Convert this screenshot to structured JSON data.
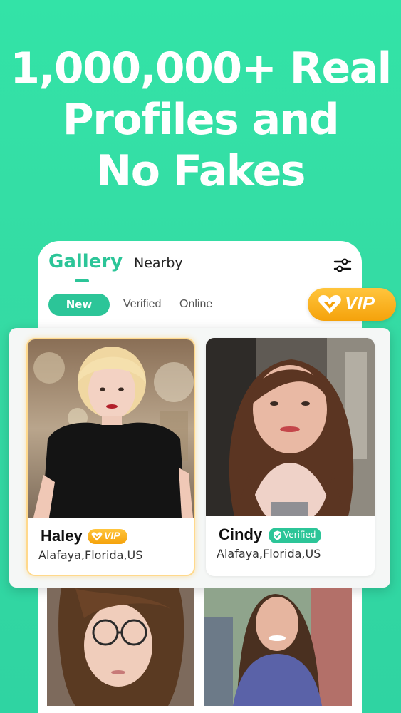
{
  "headline": {
    "line1": "1,000,000+ Real",
    "line2": "Profiles and",
    "line3": "No Fakes"
  },
  "tabs": {
    "gallery": "Gallery",
    "nearby": "Nearby"
  },
  "filters": {
    "new": "New",
    "verified": "Verified",
    "online": "Online"
  },
  "vip_pill": {
    "label": "VIP"
  },
  "profiles": [
    {
      "name": "Haley",
      "badge": "VIP",
      "location": "Alafaya,Florida,US"
    },
    {
      "name": "Cindy",
      "badge": "Verified",
      "location": "Alafaya,Florida,US"
    }
  ],
  "colors": {
    "accent": "#2cc598",
    "background": "#33e3a7",
    "vip": "#f5a20b"
  },
  "icons": {
    "filter": "filter-sliders-icon",
    "vip": "heart-vip-icon",
    "verified": "shield-check-icon"
  }
}
